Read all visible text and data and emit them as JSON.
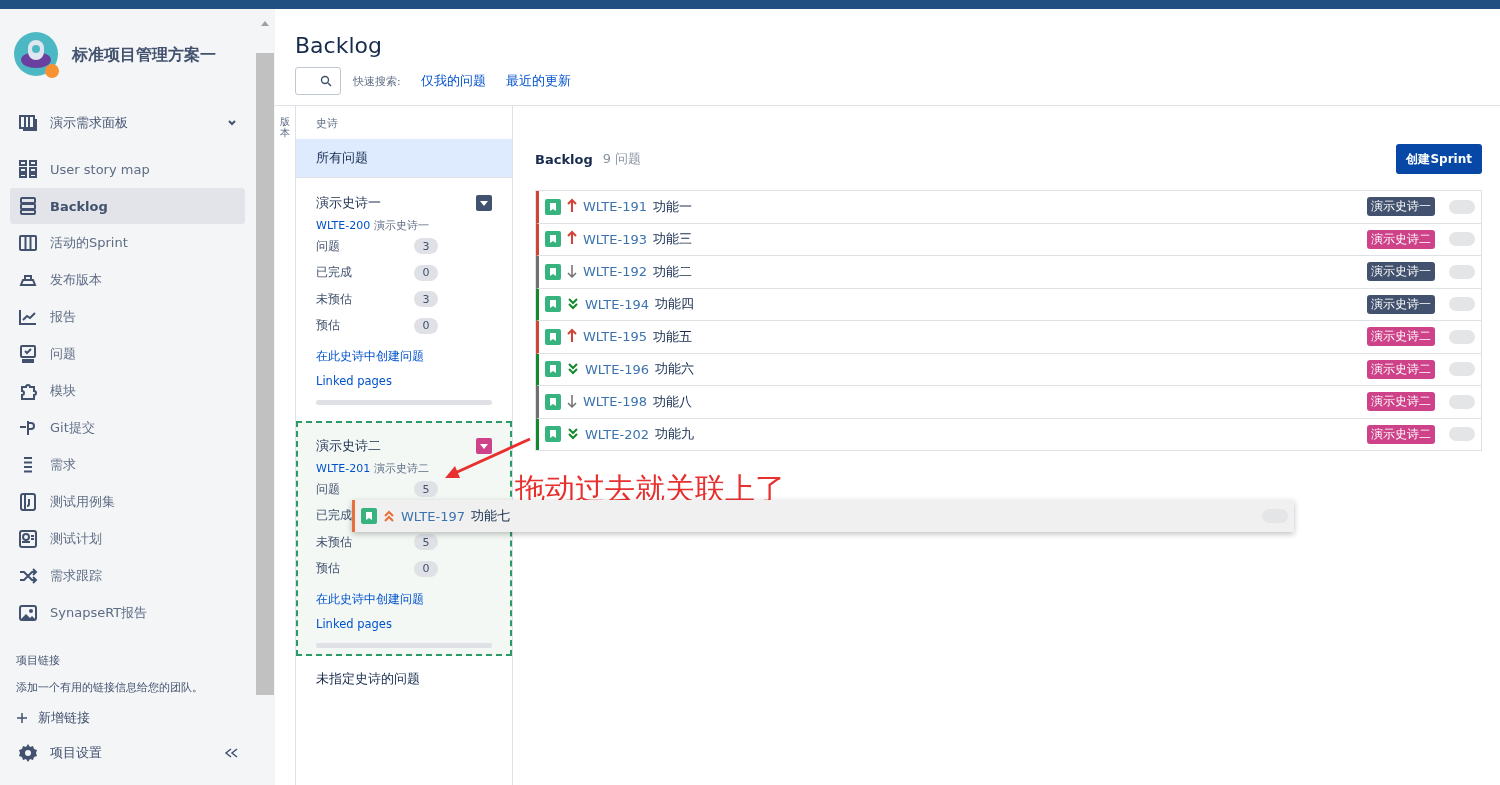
{
  "project": {
    "name": "标准项目管理方案一"
  },
  "board_selector": {
    "label": "演示需求面板"
  },
  "sidebar": {
    "items": [
      {
        "label": "User story map",
        "selected": false
      },
      {
        "label": "Backlog",
        "selected": true
      },
      {
        "label": "活动的Sprint",
        "selected": false
      },
      {
        "label": "发布版本",
        "selected": false
      },
      {
        "label": "报告",
        "selected": false
      },
      {
        "label": "问题",
        "selected": false
      },
      {
        "label": "模块",
        "selected": false
      },
      {
        "label": "Git提交",
        "selected": false
      },
      {
        "label": "需求",
        "selected": false
      },
      {
        "label": "测试用例集",
        "selected": false
      },
      {
        "label": "测试计划",
        "selected": false
      },
      {
        "label": "需求跟踪",
        "selected": false
      },
      {
        "label": "SynapseRT报告",
        "selected": false
      }
    ],
    "links_heading": "项目链接",
    "links_hint": "添加一个有用的链接信息给您的团队。",
    "add_link": "新增链接",
    "settings": "项目设置"
  },
  "page": {
    "title": "Backlog",
    "quick_search_label": "快速搜索:",
    "quick_filters": [
      "仅我的问题",
      "最近的更新"
    ],
    "side_tab": "版本"
  },
  "epics_panel": {
    "heading": "史诗",
    "all_issues": {
      "label": "所有问题",
      "selected": true
    },
    "epics": [
      {
        "name": "演示史诗一",
        "color": "#42526e",
        "key": "WLTE-200",
        "summary": "演示史诗一",
        "drop_target": false,
        "stats": [
          {
            "label": "问题",
            "count": "3"
          },
          {
            "label": "已完成",
            "count": "0"
          },
          {
            "label": "未预估",
            "count": "3"
          },
          {
            "label": "预估",
            "count": "0"
          }
        ],
        "create_link": "在此史诗中创建问题",
        "pages_link": "Linked pages"
      },
      {
        "name": "演示史诗二",
        "color": "#cd4288",
        "key": "WLTE-201",
        "summary": "演示史诗二",
        "drop_target": true,
        "stats": [
          {
            "label": "问题",
            "count": "5"
          },
          {
            "label": "已完成"
          },
          {
            "label": "未预估",
            "count": "5"
          },
          {
            "label": "预估",
            "count": "0"
          }
        ],
        "create_link": "在此史诗中创建问题",
        "pages_link": "Linked pages"
      }
    ],
    "unassigned": "未指定史诗的问题"
  },
  "backlog": {
    "title": "Backlog",
    "count": "9 问题",
    "create_button": "创建Sprint",
    "issues": [
      {
        "key": "WLTE-191",
        "summary": "功能一",
        "kind": "highest",
        "epic": "演示史诗一",
        "color": "#42526e"
      },
      {
        "key": "WLTE-193",
        "summary": "功能三",
        "kind": "highest",
        "epic": "演示史诗二",
        "color": "#cd4288"
      },
      {
        "key": "WLTE-192",
        "summary": "功能二",
        "kind": "low",
        "epic": "演示史诗一",
        "color": "#42526e"
      },
      {
        "key": "WLTE-194",
        "summary": "功能四",
        "kind": "lowest",
        "epic": "演示史诗一",
        "color": "#42526e"
      },
      {
        "key": "WLTE-195",
        "summary": "功能五",
        "kind": "highest",
        "epic": "演示史诗二",
        "color": "#cd4288"
      },
      {
        "key": "WLTE-196",
        "summary": "功能六",
        "kind": "lowest",
        "epic": "演示史诗二",
        "color": "#cd4288"
      },
      {
        "key": "WLTE-198",
        "summary": "功能八",
        "kind": "low",
        "epic": "演示史诗二",
        "color": "#cd4288"
      },
      {
        "key": "WLTE-202",
        "summary": "功能九",
        "kind": "lowest",
        "epic": "演示史诗二",
        "color": "#cd4288"
      }
    ]
  },
  "dragged_issue": {
    "key": "WLTE-197",
    "summary": "功能七",
    "kind": "high"
  },
  "annotation": {
    "text": "拖动过去就关联上了"
  }
}
